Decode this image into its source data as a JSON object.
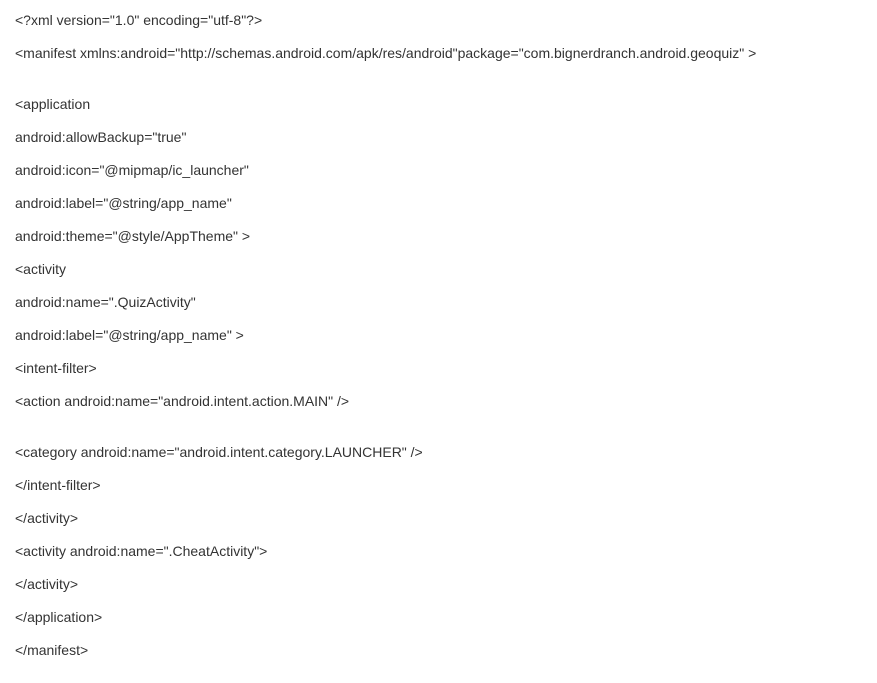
{
  "code": {
    "lines": [
      "<?xml version=\"1.0\" encoding=\"utf-8\"?>",
      "<manifest xmlns:android=\"http://schemas.android.com/apk/res/android\"package=\"com.bignerdranch.android.geoquiz\" >",
      "",
      "<application",
      "android:allowBackup=\"true\"",
      "android:icon=\"@mipmap/ic_launcher\"",
      "android:label=\"@string/app_name\"",
      "android:theme=\"@style/AppTheme\" >",
      "<activity",
      "android:name=\".QuizActivity\"",
      "android:label=\"@string/app_name\" >",
      "<intent-filter>",
      "<action android:name=\"android.intent.action.MAIN\" />",
      "",
      "<category android:name=\"android.intent.category.LAUNCHER\" />",
      "</intent-filter>",
      "</activity>",
      "<activity android:name=\".CheatActivity\">",
      "</activity>",
      "</application>",
      "</manifest>"
    ]
  }
}
